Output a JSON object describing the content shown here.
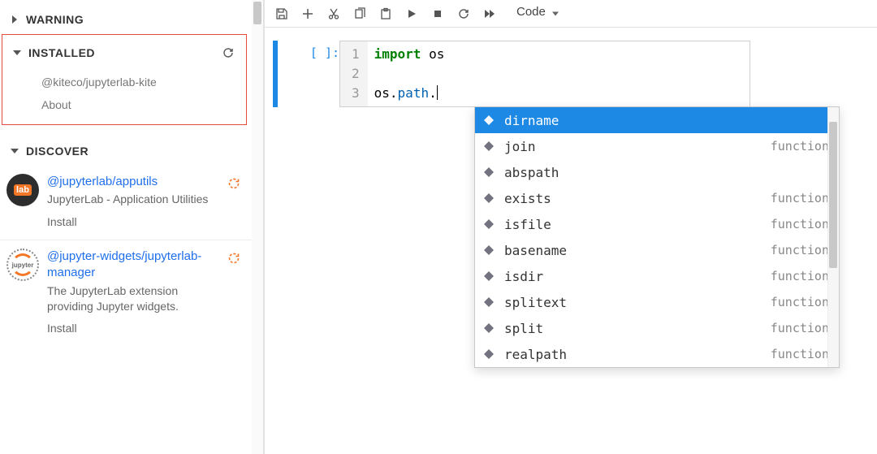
{
  "sidebar": {
    "sections": {
      "warning": {
        "label": "WARNING",
        "expanded": false
      },
      "installed": {
        "label": "INSTALLED",
        "expanded": true,
        "items": [
          {
            "name": "@kiteco/jupyterlab-kite"
          },
          {
            "name": "About"
          }
        ]
      },
      "discover": {
        "label": "DISCOVER",
        "expanded": true,
        "items": [
          {
            "title": "@jupyterlab/apputils",
            "desc": "JupyterLab - Application Utilities",
            "action": "Install",
            "logo": "lab"
          },
          {
            "title": "@jupyter-widgets/jupyterlab-manager",
            "desc": "The JupyterLab extension providing Jupyter widgets.",
            "action": "Install",
            "logo": "jupyter"
          }
        ]
      }
    }
  },
  "toolbar": {
    "cellTypeSelected": "Code"
  },
  "cell": {
    "prompt_open": "[",
    "prompt_mid": " ",
    "prompt_close": "]:",
    "gutter": [
      "1",
      "2",
      "3"
    ],
    "code_line1_kw": "import",
    "code_line1_rest": " os",
    "code_line3_a": "os.",
    "code_line3_b": "path",
    "code_line3_c": "."
  },
  "autocomplete": {
    "items": [
      {
        "name": "dirname",
        "type": "",
        "selected": true
      },
      {
        "name": "join",
        "type": "function",
        "selected": false
      },
      {
        "name": "abspath",
        "type": "",
        "selected": false
      },
      {
        "name": "exists",
        "type": "function",
        "selected": false
      },
      {
        "name": "isfile",
        "type": "function",
        "selected": false
      },
      {
        "name": "basename",
        "type": "function",
        "selected": false
      },
      {
        "name": "isdir",
        "type": "function",
        "selected": false
      },
      {
        "name": "splitext",
        "type": "function",
        "selected": false
      },
      {
        "name": "split",
        "type": "function",
        "selected": false
      },
      {
        "name": "realpath",
        "type": "function",
        "selected": false
      }
    ]
  }
}
